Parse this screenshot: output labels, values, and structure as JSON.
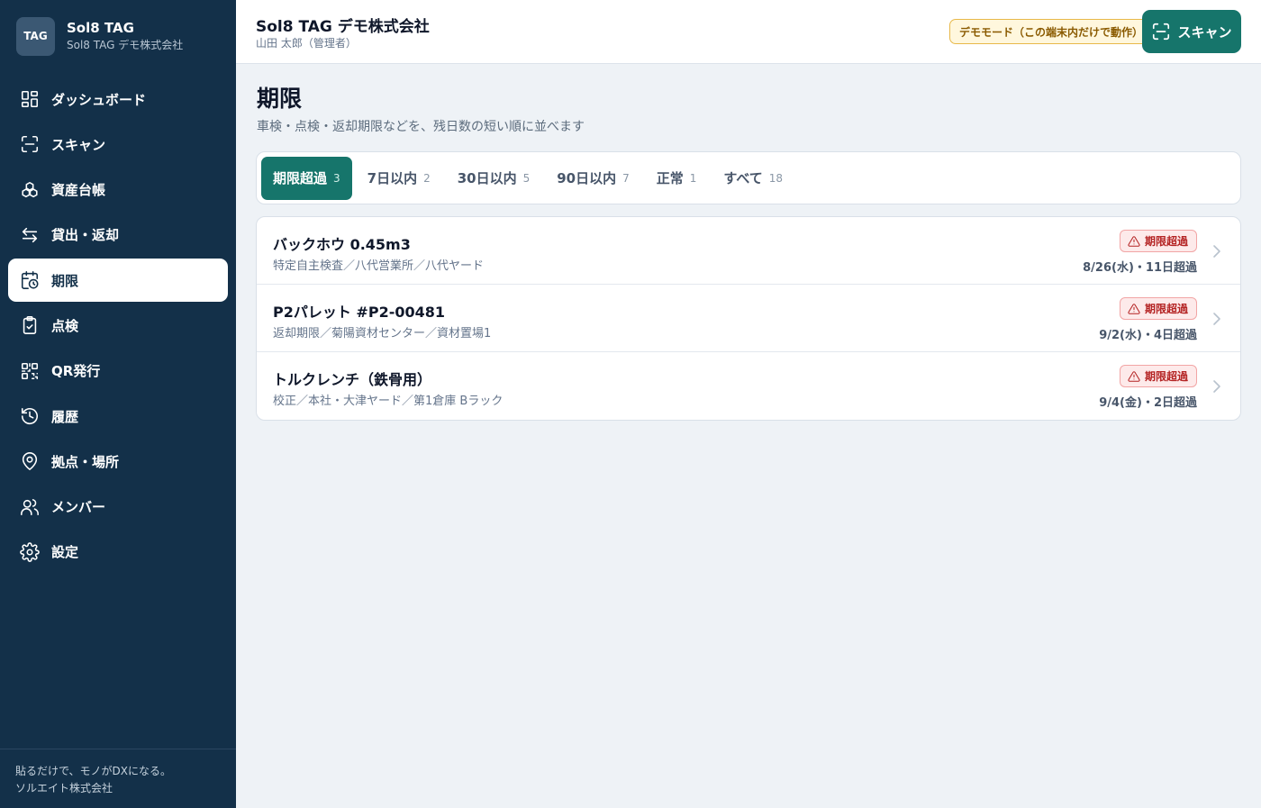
{
  "sidebar": {
    "brand_logo": "TAG",
    "brand_name": "Sol8 TAG",
    "brand_sub": "Sol8 TAG デモ株式会社",
    "items": [
      {
        "label": "ダッシュボード",
        "icon": "dashboard-icon"
      },
      {
        "label": "スキャン",
        "icon": "scan-icon"
      },
      {
        "label": "資産台帳",
        "icon": "boxes-icon"
      },
      {
        "label": "貸出・返却",
        "icon": "swap-icon"
      },
      {
        "label": "期限",
        "icon": "calendar-clock-icon",
        "active": true
      },
      {
        "label": "点検",
        "icon": "clipboard-check-icon"
      },
      {
        "label": "QR発行",
        "icon": "qr-icon"
      },
      {
        "label": "履歴",
        "icon": "history-icon"
      },
      {
        "label": "拠点・場所",
        "icon": "map-pin-icon"
      },
      {
        "label": "メンバー",
        "icon": "users-icon"
      },
      {
        "label": "設定",
        "icon": "gear-icon"
      }
    ],
    "footer_line1": "貼るだけで、モノがDXになる。",
    "footer_line2": "ソルエイト株式会社"
  },
  "header": {
    "title": "Sol8 TAG デモ株式会社",
    "user": "山田 太郎（管理者）",
    "demo_badge": "デモモード（この端末内だけで動作）",
    "scan_label": "スキャン"
  },
  "main": {
    "title": "期限",
    "description": "車検・点検・返却期限などを、残日数の短い順に並べます",
    "tabs": [
      {
        "label": "期限超過",
        "count": "3",
        "active": true
      },
      {
        "label": "7日以内",
        "count": "2"
      },
      {
        "label": "30日以内",
        "count": "5"
      },
      {
        "label": "90日以内",
        "count": "7"
      },
      {
        "label": "正常",
        "count": "1"
      },
      {
        "label": "すべて",
        "count": "18"
      }
    ],
    "items": [
      {
        "title": "バックホウ 0.45m3",
        "sub": "特定自主検査／八代営業所／八代ヤード",
        "badge": "期限超過",
        "date": "8/26(水)・11日超過"
      },
      {
        "title": "P2パレット #P2-00481",
        "sub": "返却期限／菊陽資材センター／資材置場1",
        "badge": "期限超過",
        "date": "9/2(水)・4日超過"
      },
      {
        "title": "トルクレンチ（鉄骨用）",
        "sub": "校正／本社・大津ヤード／第1倉庫 Bラック",
        "badge": "期限超過",
        "date": "9/4(金)・2日超過"
      }
    ]
  },
  "colors": {
    "sidebar_bg": "#133049",
    "accent": "#16756b",
    "danger": "#b42323",
    "warning": "#e8b94a"
  }
}
